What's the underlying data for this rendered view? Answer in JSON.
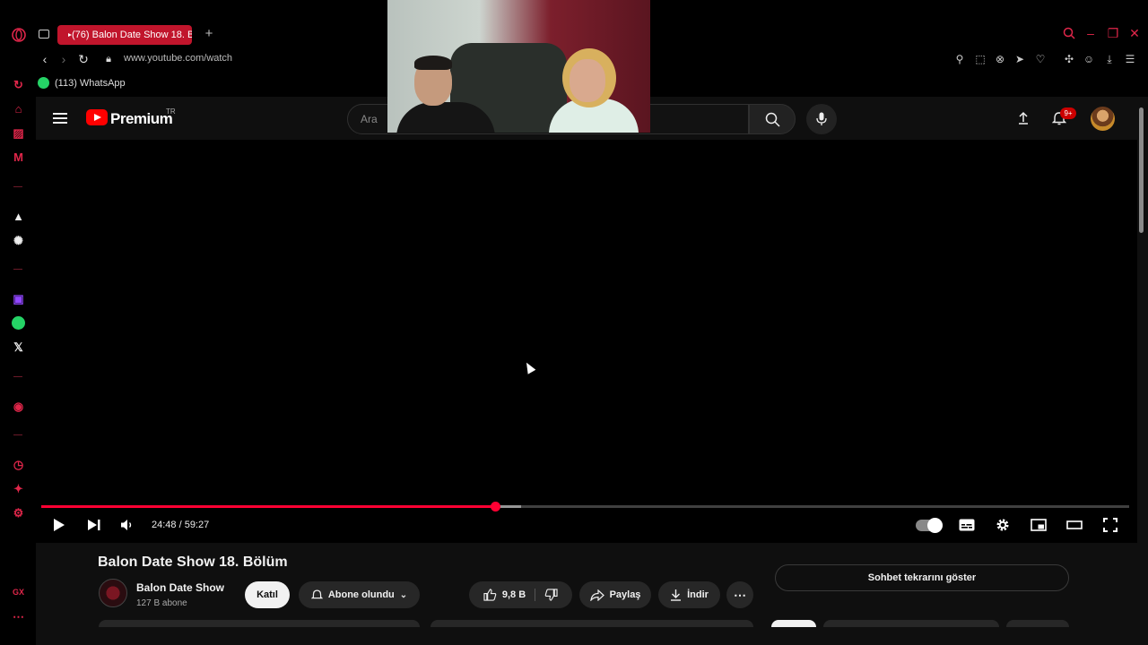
{
  "browser": {
    "tab_title": "(76) Balon Date Show 18. B",
    "url": "www.youtube.com/watch",
    "bookmark_whatsapp": "(113) WhatsApp"
  },
  "youtube": {
    "logo_text": "Premium",
    "region": "TR",
    "search_placeholder": "Ara",
    "notification_badge": "9+"
  },
  "player": {
    "time_display": "24:48 / 59:27",
    "progress_fraction": 0.417,
    "buffer_fraction": 0.441
  },
  "video": {
    "title": "Balon Date Show 18. Bölüm",
    "channel_name": "Balon Date Show",
    "subscribers": "127 B abone",
    "join_label": "Katıl",
    "subscribed_label": "Abone olundu",
    "like_count": "9,8 B",
    "share_label": "Paylaş",
    "download_label": "İndir",
    "chat_replay_label": "Sohbet tekrarını göster"
  },
  "colors": {
    "opera_accent": "#e0264a",
    "youtube_red": "#ff0000",
    "progress_red": "#ff0033"
  }
}
